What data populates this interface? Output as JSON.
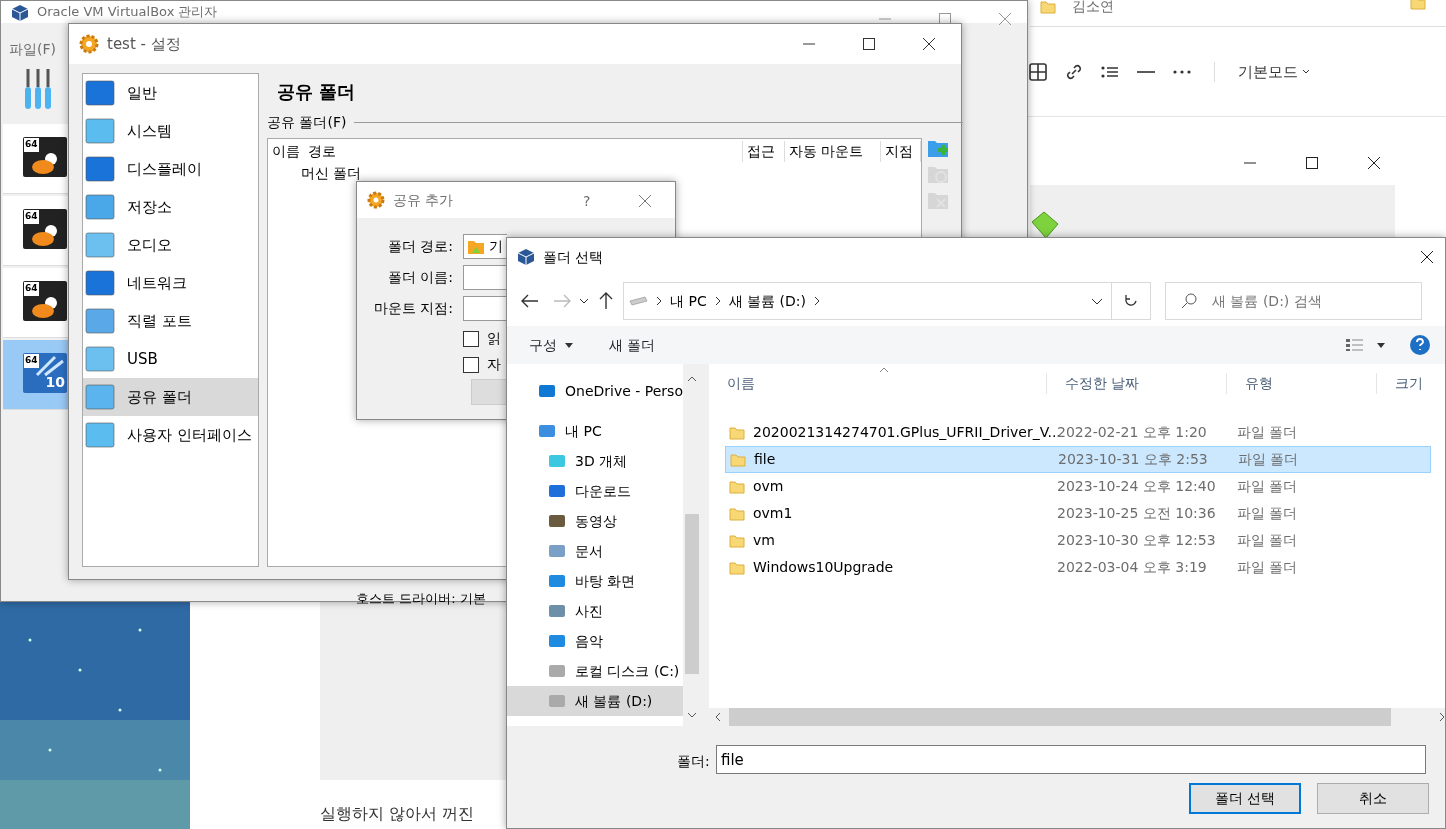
{
  "editor": {
    "folders": [
      {
        "label": "김소연"
      }
    ],
    "mode": "기본모드",
    "body_text": "실행하지 않아서 꺼진"
  },
  "manager": {
    "title": "Oracle VM VirtualBox 관리자",
    "menu": [
      "파일(F)"
    ],
    "vms": [
      {
        "kind": "linux",
        "badge": "64",
        "selected": false
      },
      {
        "kind": "linux",
        "badge": "64",
        "selected": false
      },
      {
        "kind": "linux",
        "badge": "64",
        "selected": false
      },
      {
        "kind": "windows",
        "badge": "64",
        "version": "10",
        "selected": true
      }
    ],
    "status_text": "호스트 드라이버: 기본"
  },
  "settings": {
    "title": "test - 설정",
    "categories": [
      {
        "label": "일반",
        "selected": false
      },
      {
        "label": "시스템",
        "selected": false
      },
      {
        "label": "디스플레이",
        "selected": false
      },
      {
        "label": "저장소",
        "selected": false
      },
      {
        "label": "오디오",
        "selected": false
      },
      {
        "label": "네트워크",
        "selected": false
      },
      {
        "label": "직렬 포트",
        "selected": false
      },
      {
        "label": "USB",
        "selected": false
      },
      {
        "label": "공유 폴더",
        "selected": true
      },
      {
        "label": "사용자 인터페이스",
        "selected": false
      }
    ],
    "page_title": "공유 폴더",
    "group_label": "공유 폴더(F)",
    "columns": [
      "이름",
      "경로",
      "접근",
      "자동 마운트",
      "지점"
    ],
    "rows": [
      {
        "name": "머신 폴더"
      }
    ],
    "tools": [
      {
        "disabled": false
      },
      {
        "disabled": true
      },
      {
        "disabled": true
      }
    ]
  },
  "add_share": {
    "title": "공유 추가",
    "help": "?",
    "fields": [
      {
        "label": "폴더 경로:",
        "value": "기"
      },
      {
        "label": "폴더 이름:"
      },
      {
        "label": "마운트 지점:"
      }
    ],
    "checkboxes": [
      {
        "label": "읽",
        "checked": false
      },
      {
        "label": "자",
        "checked": false
      }
    ]
  },
  "folder_picker": {
    "title": "폴더 선택",
    "breadcrumb": [
      "내 PC",
      "새 볼륨 (D:)"
    ],
    "search_placeholder": "새 볼륨 (D:) 검색",
    "toolbar": [
      "구성",
      "새 폴더"
    ],
    "nav": [
      {
        "label": "OneDrive - Perso",
        "selected": false
      },
      {
        "label": "내 PC",
        "selected": false,
        "children": [
          {
            "label": "3D 개체",
            "selected": false
          },
          {
            "label": "다운로드",
            "selected": false
          },
          {
            "label": "동영상",
            "selected": false
          },
          {
            "label": "문서",
            "selected": false
          },
          {
            "label": "바탕 화면",
            "selected": false
          },
          {
            "label": "사진",
            "selected": false
          },
          {
            "label": "음악",
            "selected": false
          },
          {
            "label": "로컬 디스크 (C:)",
            "selected": false
          },
          {
            "label": "새 볼륨 (D:)",
            "selected": true
          }
        ]
      }
    ],
    "columns": [
      "이름",
      "수정한 날짜",
      "유형",
      "크기"
    ],
    "files": [
      {
        "name": "2020021314274701.GPlus_UFRII_Driver_V...",
        "date": "2022-02-21 오후 1:20",
        "type": "파일 폴더",
        "selected": false
      },
      {
        "name": "file",
        "date": "2023-10-31 오후 2:53",
        "type": "파일 폴더",
        "selected": true
      },
      {
        "name": "ovm",
        "date": "2023-10-24 오후 12:40",
        "type": "파일 폴더",
        "selected": false
      },
      {
        "name": "ovm1",
        "date": "2023-10-25 오전 10:36",
        "type": "파일 폴더",
        "selected": false
      },
      {
        "name": "vm",
        "date": "2023-10-30 오후 12:53",
        "type": "파일 폴더",
        "selected": false
      },
      {
        "name": "Windows10Upgrade",
        "date": "2022-03-04 오후 3:19",
        "type": "파일 폴더",
        "selected": false
      }
    ],
    "folder_label": "폴더:",
    "folder_value": "file",
    "buttons": [
      {
        "label": "폴더 선택",
        "primary": true
      },
      {
        "label": "취소",
        "primary": false
      }
    ]
  }
}
